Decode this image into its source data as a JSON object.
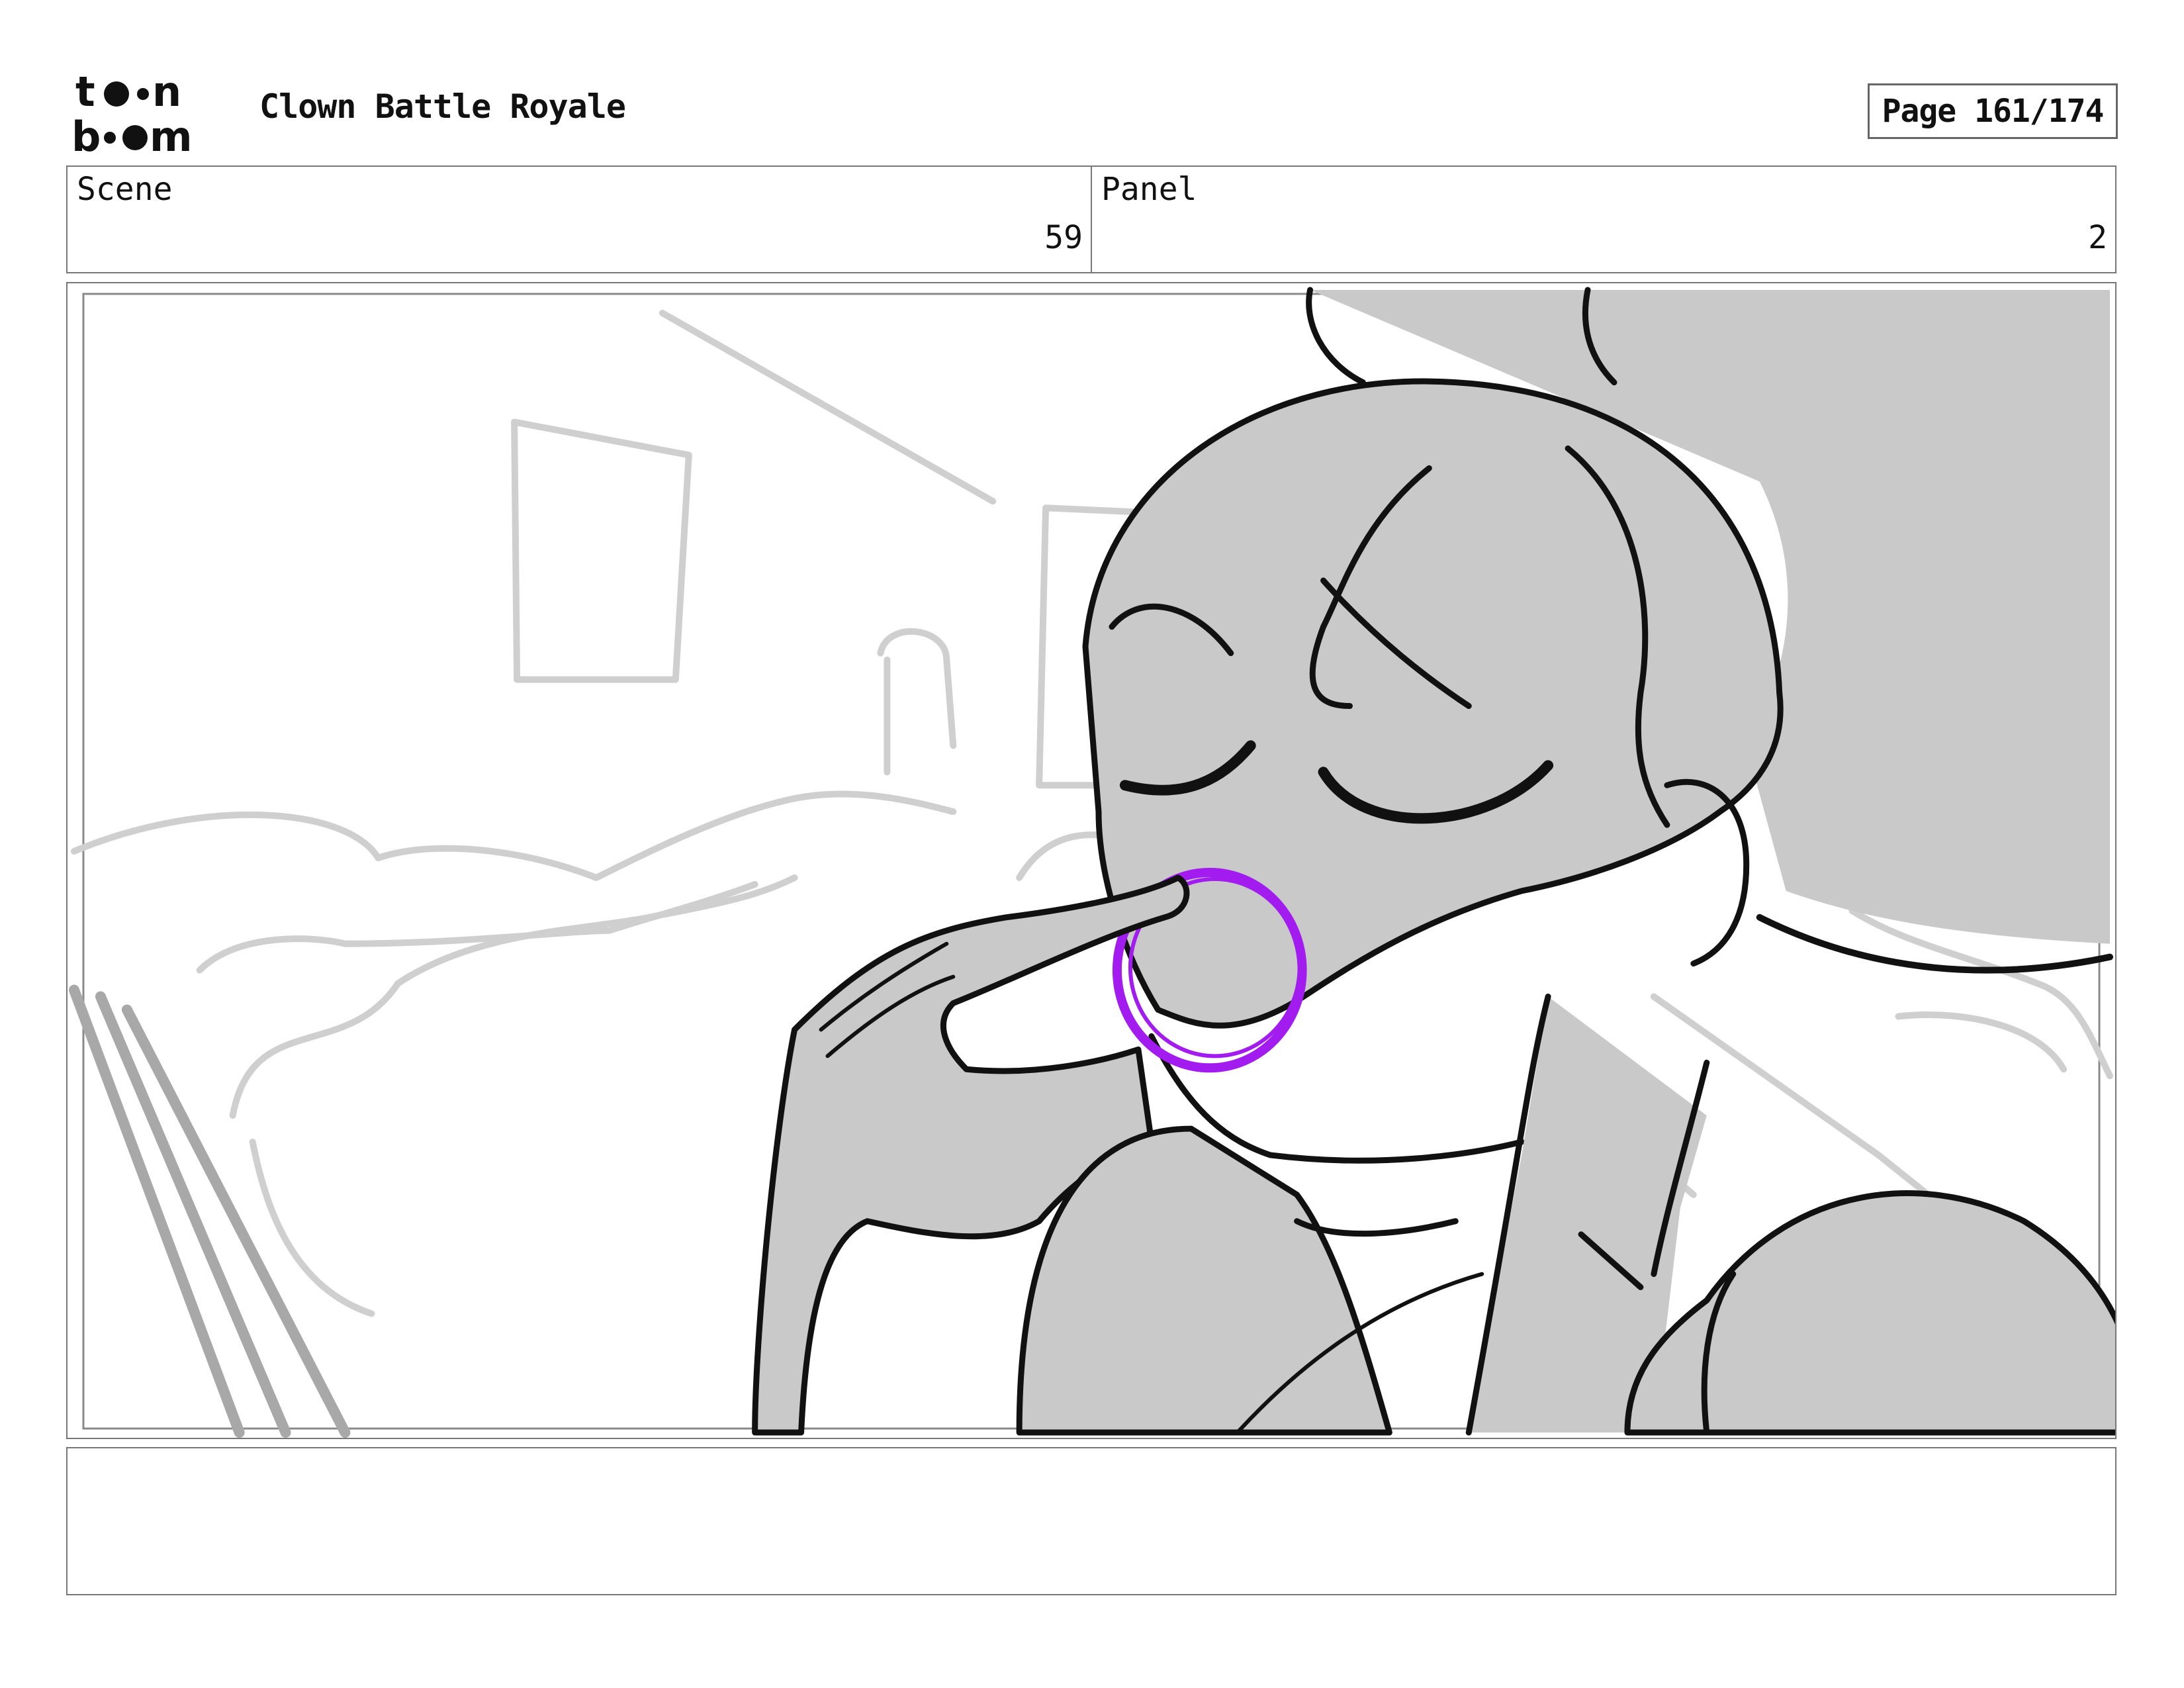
{
  "header": {
    "logo_text": "toon boom",
    "title": "Clown Battle Royale",
    "page_label": "Page 161/174"
  },
  "info": {
    "scene_label": "Scene",
    "scene_value": "59",
    "panel_label": "Panel",
    "panel_value": "2"
  },
  "panel": {
    "description_icon": "storyboard-drawing",
    "colors": {
      "character_fill": "#c9c9c9",
      "ink": "#111111",
      "background_sketch": "#cfcfcf",
      "mouth_accent": "#a21cf0"
    }
  },
  "notes": {
    "text": ""
  }
}
